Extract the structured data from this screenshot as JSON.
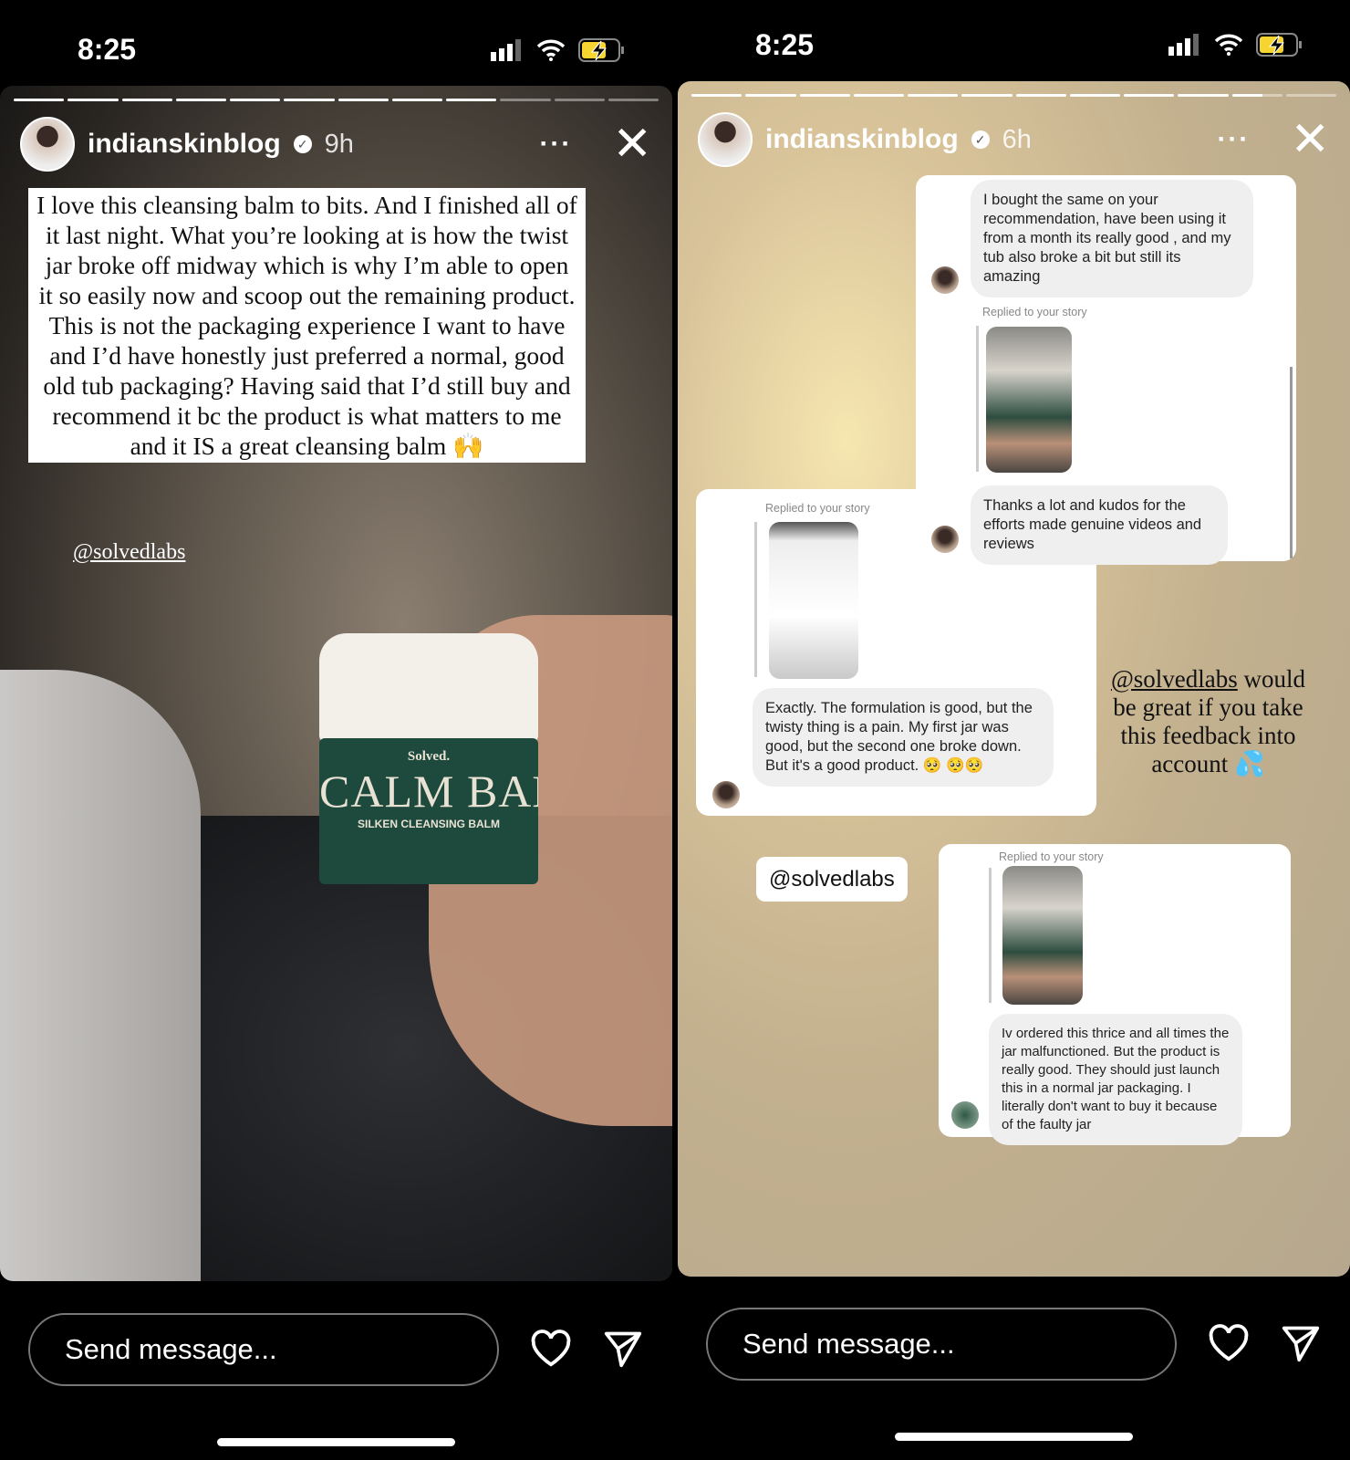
{
  "status_bar": [
    {
      "time": "8:25"
    },
    {
      "time": "8:25"
    }
  ],
  "stories": [
    {
      "username": "indianskinblog",
      "verified": true,
      "time_ago": "9h",
      "progress": {
        "segments": 12,
        "completed": 9,
        "current_fraction": 0.0
      },
      "caption": "I love this cleansing balm to bits. And I finished all of it last night. What you’re looking at is how the twist jar broke off midway which is why I’m able to open it so easily now and scoop out the remaining product. This is not the packaging experience I want to have and I’d have honestly just preferred a normal, good old tub packaging? Having said that I’d still buy and recommend it bc the product is what matters to me and it IS a great cleansing balm 🙌",
      "mention": "@solvedlabs",
      "product": {
        "brand": "Solved.",
        "name": "CALM BALM",
        "subtitle": "SILKEN CLEANSING BALM"
      },
      "send_placeholder": "Send message..."
    },
    {
      "username": "indianskinblog",
      "verified": true,
      "time_ago": "6h",
      "progress": {
        "segments": 12,
        "completed": 10,
        "current_fraction": 0.6
      },
      "messages": [
        {
          "text": "I bought the same on your recommendation, have been using it from a month its really good , and my tub also broke a bit but still its amazing",
          "replied": "Replied to your story",
          "reply": "Thanks a lot and kudos for the efforts made genuine videos and reviews"
        },
        {
          "replied": "Replied to your story",
          "text": "Exactly. The formulation is good, but the twisty thing is a pain. My first jar was good, but the second one broke down. But it's a good product. 🥺 🥺🥺"
        },
        {
          "replied": "Replied to your story",
          "text": "Iv ordered this thrice and all times the jar malfunctioned. But the product is really good. They should just launch this in a normal jar packaging. I literally don't want to buy it because of the faulty jar"
        }
      ],
      "caption_mention": "@solvedlabs",
      "caption_rest": " would be great if you take this feedback into account 💦",
      "mention_sticker": "@solvedlabs",
      "send_placeholder": "Send message..."
    }
  ],
  "colors": {
    "accent_sticker": "#f2a03d",
    "battery": "#f7d531",
    "jar": "#1e4a3e"
  }
}
